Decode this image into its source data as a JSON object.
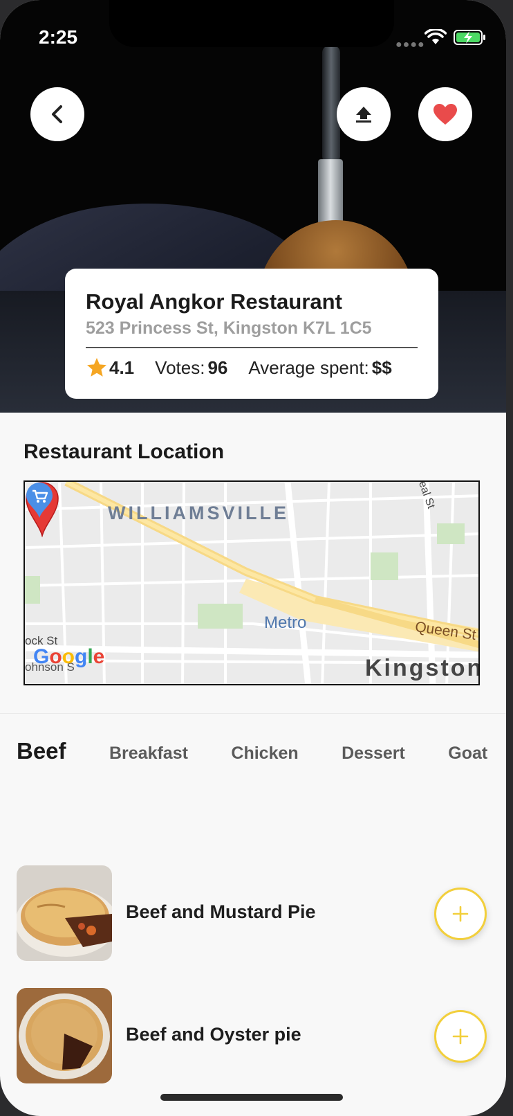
{
  "status_bar": {
    "time": "2:25"
  },
  "restaurant": {
    "name": "Royal Angkor Restaurant",
    "address": "523 Princess St, Kingston K7L 1C5",
    "rating": "4.1",
    "votes_label": "Votes:",
    "votes_value": "96",
    "avg_label": "Average spent:",
    "avg_value": "$$"
  },
  "location": {
    "title": "Restaurant Location",
    "map": {
      "area_label": "WILLIAMSVILLE",
      "poi_label": "Metro",
      "street_queen": "Queen St",
      "street_left1": "ock St",
      "street_left2": "ohnson S",
      "street_neal": "eal St",
      "city_label": "Kingston",
      "logo": "Google"
    }
  },
  "categories": {
    "items": [
      "Beef",
      "Breakfast",
      "Chicken",
      "Dessert",
      "Goat"
    ],
    "active": "Beef"
  },
  "menu": {
    "items": [
      {
        "name": "Beef and Mustard Pie"
      },
      {
        "name": "Beef and Oyster pie"
      }
    ]
  },
  "colors": {
    "favorite": "#e94b4b",
    "add_button_accent": "#f2cf3c",
    "rating_star": "#f5a623",
    "map_pin": "#e53935"
  },
  "icons": {
    "back": "chevron-left-icon",
    "share": "upload-icon",
    "favorite": "heart-icon",
    "rating": "star-icon",
    "add": "plus-icon"
  }
}
